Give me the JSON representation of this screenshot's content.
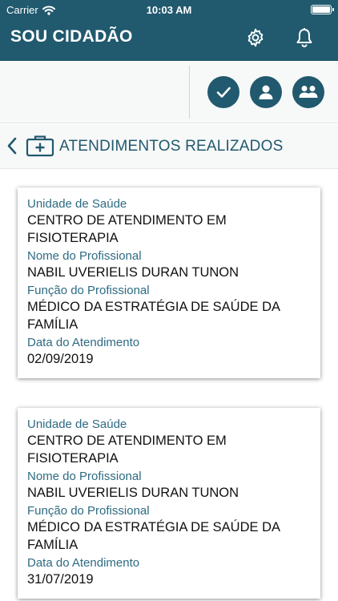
{
  "status_bar": {
    "carrier": "Carrier",
    "time": "10:03 AM"
  },
  "nav": {
    "title": "SOU CIDADÃO"
  },
  "section": {
    "title": "ATENDIMENTOS REALIZADOS"
  },
  "cards": [
    {
      "unidade_label": "Unidade de Saúde",
      "unidade_line1": "CENTRO DE ATENDIMENTO EM",
      "unidade_line2": "FISIOTERAPIA",
      "profissional_label": "Nome do Profissional",
      "profissional": "NABIL UVERIELIS DURAN TUNON",
      "funcao_label": "Função do Profissional",
      "funcao_line1": "MÉDICO DA ESTRATÉGIA DE SAÚDE DA",
      "funcao_line2": "FAMÍLIA",
      "data_label": "Data do Atendimento",
      "data": "02/09/2019"
    },
    {
      "unidade_label": "Unidade de Saúde",
      "unidade_line1": "CENTRO DE ATENDIMENTO EM",
      "unidade_line2": "FISIOTERAPIA",
      "profissional_label": "Nome do Profissional",
      "profissional": "NABIL UVERIELIS DURAN TUNON",
      "funcao_label": "Função do Profissional",
      "funcao_line1": "MÉDICO DA ESTRATÉGIA DE SAÚDE DA",
      "funcao_line2": "FAMÍLIA",
      "data_label": "Data do Atendimento",
      "data": "31/07/2019"
    }
  ],
  "icons": {
    "wifi": "wifi-icon",
    "battery": "battery-icon",
    "settings": "gear-icon",
    "notifications": "bell-icon",
    "check": "check-icon",
    "profile": "user-icon",
    "group": "users-icon",
    "back": "chevron-left-icon",
    "section": "medical-kit-icon"
  },
  "colors": {
    "primary": "#21596e",
    "label": "#2d6b82",
    "background": "#f7f8f8"
  }
}
